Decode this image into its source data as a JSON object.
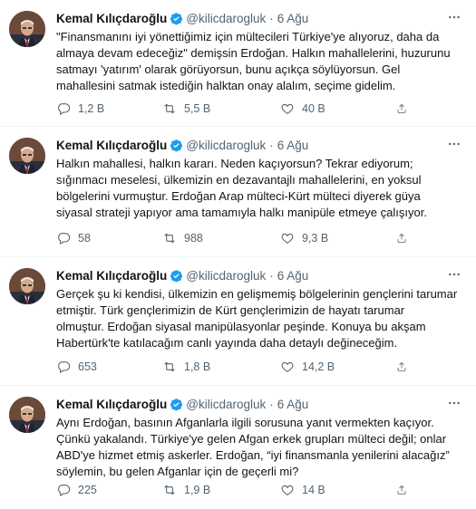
{
  "colors": {
    "text": "#0f1419",
    "muted": "#536471",
    "verified": "#1d9bf0"
  },
  "icons": {
    "verified": "verified-badge-icon",
    "more": "more-icon",
    "reply": "reply-icon",
    "retweet": "retweet-icon",
    "like": "heart-icon",
    "share": "share-icon"
  },
  "tweets": [
    {
      "name": "Kemal Kılıçdaroğlu",
      "handle": "@kilicdarogluk",
      "dot": "·",
      "time": "6 Ağu",
      "text": "\"Finansmanını iyi yönettiğimiz için mültecileri Türkiye'ye alıyoruz, daha da\nalmaya devam edeceğiz\" demişsin Erdoğan. Halkın mahallelerini, huzurunu\nsatmayı 'yatırım' olarak görüyorsun, bunu açıkça söylüyorsun. Gel\nmahallesini satmak istediğin halktan onay alalım, seçime gidelim.",
      "replies": "1,2 B",
      "retweets": "5,5 B",
      "likes": "40 B"
    },
    {
      "name": "Kemal Kılıçdaroğlu",
      "handle": "@kilicdarogluk",
      "dot": "·",
      "time": "6 Ağu",
      "text": "Halkın mahallesi, halkın kararı. Neden kaçıyorsun? Tekrar ediyorum;\nsığınmacı meselesi, ülkemizin en dezavantajlı mahallelerini, en yoksul\nbölgelerini vurmuştur. Erdoğan Arap mülteci-Kürt mülteci diyerek güya\nsiyasal strateji yapıyor ama tamamıyla halkı manipüle etmeye çalışıyor.",
      "replies": "58",
      "retweets": "988",
      "likes": "9,3 B"
    },
    {
      "name": "Kemal Kılıçdaroğlu",
      "handle": "@kilicdarogluk",
      "dot": "·",
      "time": "6 Ağu",
      "text": "Gerçek şu ki kendisi, ülkemizin en gelişmemiş bölgelerinin gençlerini tarumar\netmiştir. Türk gençlerimizin de Kürt gençlerimizin de hayatı tarumar\nolmuştur. Erdoğan siyasal manipülasyonlar peşinde. Konuya bu akşam\nHabertürk'te katılacağım canlı yayında daha detaylı değineceğim.",
      "replies": "653",
      "retweets": "1,8 B",
      "likes": "14,2 B"
    },
    {
      "name": "Kemal Kılıçdaroğlu",
      "handle": "@kilicdarogluk",
      "dot": "·",
      "time": "6 Ağu",
      "text": "Aynı Erdoğan, basının Afganlarla ilgili sorusuna yanıt vermekten kaçıyor.\nÇünkü yakalandı. Türkiye'ye gelen Afgan erkek grupları mülteci değil; onlar\nABD'ye hizmet etmiş askerler. Erdoğan, “iyi finansmanla yenilerini alacağız”\nsöylemin, bu gelen Afganlar için de geçerli mi?",
      "replies": "225",
      "retweets": "1,9 B",
      "likes": "14 B"
    }
  ]
}
